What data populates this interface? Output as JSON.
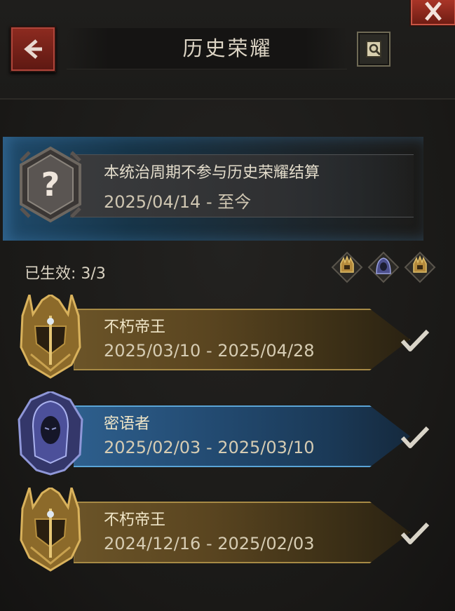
{
  "header": {
    "title": "历史荣耀",
    "back_icon": "chevron-left-icon",
    "close_icon": "close-icon",
    "help_icon": "search-scroll-icon"
  },
  "current": {
    "line1": "本统治周期不参与历史荣耀结算",
    "line2": "2025/04/14 - 至今",
    "badge_icon": "question-mark-icon"
  },
  "status": {
    "label": "已生效: 3/3"
  },
  "entries": [
    {
      "name": "不朽帝王",
      "dates": "2025/03/10 - 2025/04/28",
      "style": "gold",
      "icon": "gold-helmet-icon"
    },
    {
      "name": "密语者",
      "dates": "2025/02/03 - 2025/03/10",
      "style": "blue",
      "icon": "hooded-figure-icon"
    },
    {
      "name": "不朽帝王",
      "dates": "2024/12/16 - 2025/02/03",
      "style": "gold",
      "icon": "gold-helmet-icon"
    }
  ],
  "colors": {
    "gold_band": "#6b5428",
    "blue_band": "#2e5f8d",
    "back_button": "#8e2b20"
  }
}
